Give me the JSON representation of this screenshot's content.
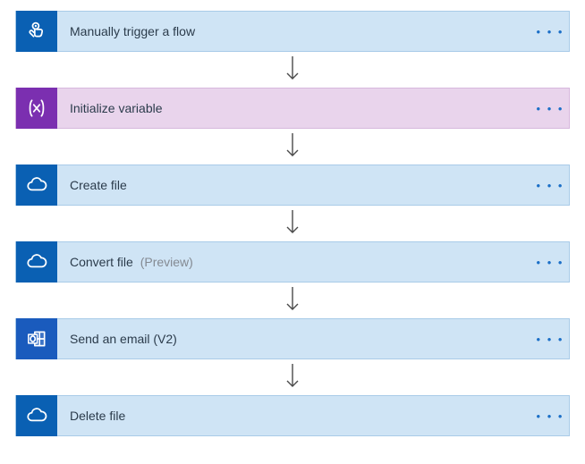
{
  "flow": {
    "steps": [
      {
        "id": "trigger",
        "label": "Manually trigger a flow",
        "suffix": "",
        "icon": "tap-icon",
        "style": "blue",
        "tile": "blue"
      },
      {
        "id": "initvar",
        "label": "Initialize variable",
        "suffix": "",
        "icon": "var-icon",
        "style": "purple",
        "tile": "purple"
      },
      {
        "id": "create",
        "label": "Create file",
        "suffix": "",
        "icon": "cloud-icon",
        "style": "blue",
        "tile": "blue"
      },
      {
        "id": "convert",
        "label": "Convert file",
        "suffix": "(Preview)",
        "icon": "cloud-icon",
        "style": "blue",
        "tile": "blue"
      },
      {
        "id": "email",
        "label": "Send an email (V2)",
        "suffix": "",
        "icon": "outlook-icon",
        "style": "outlook",
        "tile": "blue"
      },
      {
        "id": "delete",
        "label": "Delete file",
        "suffix": "",
        "icon": "cloud-icon",
        "style": "blue",
        "tile": "blue"
      }
    ]
  },
  "menu_glyph": "• • •"
}
